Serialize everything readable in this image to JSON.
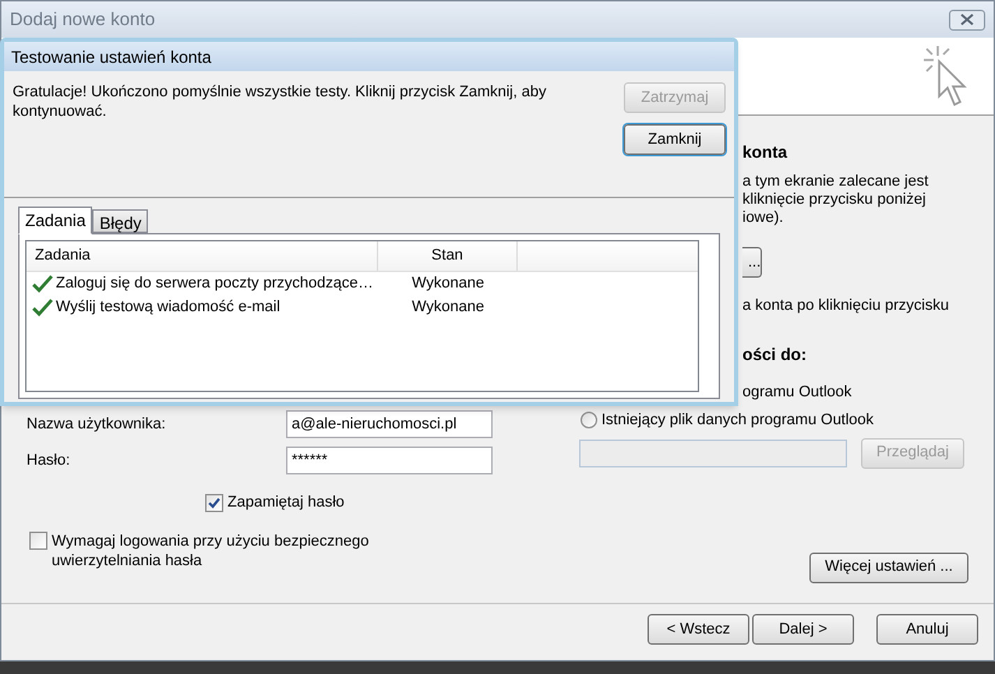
{
  "window": {
    "title": "Dodaj nowe konto"
  },
  "right_panel": {
    "heading": "konta",
    "lines": [
      "a tym ekranie zalecane jest",
      "kliknięcie przycisku poniżej",
      "iowe)."
    ],
    "partial_button": "...",
    "note": "a konta po kliknięciu przycisku",
    "heading2": "ości do:",
    "option_text": "ogramu Outlook",
    "existing_file_option": {
      "label": "Istniejący plik danych programu Outlook",
      "selected": false
    },
    "path_field": {
      "disabled": true
    },
    "browse_button": {
      "label": "Przeglądaj",
      "disabled": true
    },
    "more_settings_button": "Więcej ustawień ..."
  },
  "fields": [
    {
      "label": "Nazwa użytkownika:",
      "value": "a@ale-nieruchomosci.pl"
    },
    {
      "label": "Hasło:",
      "value": "******"
    }
  ],
  "checkboxes": [
    {
      "label": "Zapamiętaj hasło",
      "checked": true
    },
    {
      "label": "Wymagaj logowania przy użyciu bezpiecznego uwierzytelniania hasła",
      "checked": false
    }
  ],
  "buttons": [
    {
      "label": "< Wstecz"
    },
    {
      "label": "Dalej >"
    },
    {
      "label": "Anuluj"
    }
  ],
  "dialog": {
    "title": "Testowanie ustawień konta",
    "message": "Gratulacje! Ukończono pomyślnie wszystkie testy. Kliknij przycisk Zamknij, aby kontynuować.",
    "buttons": [
      {
        "label": "Zatrzymaj",
        "disabled": true
      },
      {
        "label": "Zamknij",
        "disabled": false
      }
    ],
    "tabs": [
      {
        "label": "Zadania",
        "selected": true
      },
      {
        "label": "Błędy",
        "selected": false
      }
    ],
    "table": {
      "columns": [
        "Zadania",
        "Stan"
      ],
      "rows": [
        {
          "task": "Zaloguj się do serwera poczty przychodzące…",
          "status": "Wykonane",
          "done": true
        },
        {
          "task": "Wyślij testową wiadomość e-mail",
          "status": "Wykonane",
          "done": true
        }
      ]
    }
  }
}
